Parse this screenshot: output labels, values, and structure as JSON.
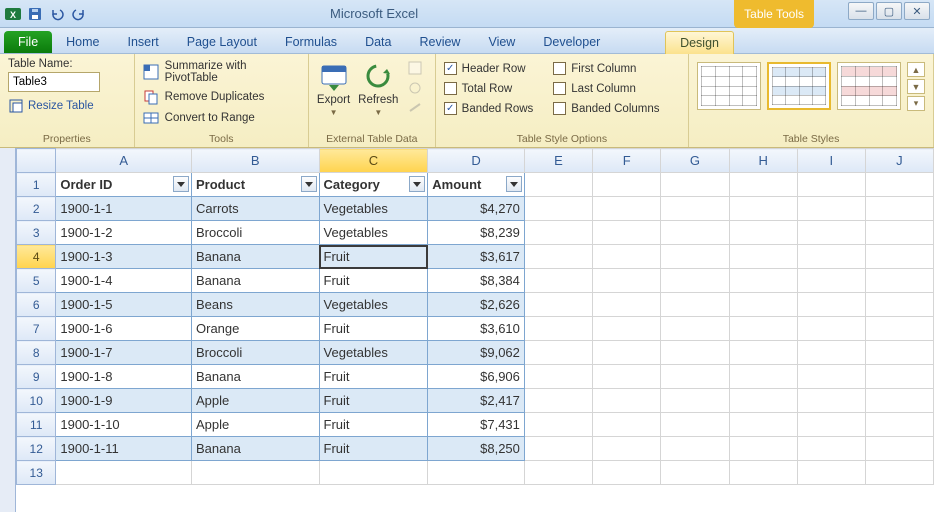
{
  "titlebar": {
    "app_title": "Microsoft Excel",
    "contextual_tab_group": "Table Tools"
  },
  "tabs": {
    "file": "File",
    "list": [
      "Home",
      "Insert",
      "Page Layout",
      "Formulas",
      "Data",
      "Review",
      "View",
      "Developer"
    ],
    "context": "Design"
  },
  "ribbon": {
    "properties": {
      "label": "Properties",
      "table_name_label": "Table Name:",
      "table_name_value": "Table3",
      "resize_label": "Resize Table"
    },
    "tools": {
      "label": "Tools",
      "items": [
        "Summarize with PivotTable",
        "Remove Duplicates",
        "Convert to Range"
      ]
    },
    "external": {
      "label": "External Table Data",
      "export": "Export",
      "refresh": "Refresh"
    },
    "style_options": {
      "label": "Table Style Options",
      "left": [
        "Header Row",
        "Total Row",
        "Banded Rows"
      ],
      "left_checked": [
        true,
        false,
        true
      ],
      "right": [
        "First Column",
        "Last Column",
        "Banded Columns"
      ],
      "right_checked": [
        false,
        false,
        false
      ]
    },
    "styles": {
      "label": "Table Styles"
    }
  },
  "sheet": {
    "columns": [
      "A",
      "B",
      "C",
      "D",
      "E",
      "F",
      "G",
      "H",
      "I",
      "J"
    ],
    "active_col": "C",
    "active_row": 4,
    "headers": [
      "Order ID",
      "Product",
      "Category",
      "Amount"
    ],
    "rows": [
      {
        "r": 2,
        "id": "1900-1-1",
        "product": "Carrots",
        "category": "Vegetables",
        "amount": "$4,270"
      },
      {
        "r": 3,
        "id": "1900-1-2",
        "product": "Broccoli",
        "category": "Vegetables",
        "amount": "$8,239"
      },
      {
        "r": 4,
        "id": "1900-1-3",
        "product": "Banana",
        "category": "Fruit",
        "amount": "$3,617"
      },
      {
        "r": 5,
        "id": "1900-1-4",
        "product": "Banana",
        "category": "Fruit",
        "amount": "$8,384"
      },
      {
        "r": 6,
        "id": "1900-1-5",
        "product": "Beans",
        "category": "Vegetables",
        "amount": "$2,626"
      },
      {
        "r": 7,
        "id": "1900-1-6",
        "product": "Orange",
        "category": "Fruit",
        "amount": "$3,610"
      },
      {
        "r": 8,
        "id": "1900-1-7",
        "product": "Broccoli",
        "category": "Vegetables",
        "amount": "$9,062"
      },
      {
        "r": 9,
        "id": "1900-1-8",
        "product": "Banana",
        "category": "Fruit",
        "amount": "$6,906"
      },
      {
        "r": 10,
        "id": "1900-1-9",
        "product": "Apple",
        "category": "Fruit",
        "amount": "$2,417"
      },
      {
        "r": 11,
        "id": "1900-1-10",
        "product": "Apple",
        "category": "Fruit",
        "amount": "$7,431"
      },
      {
        "r": 12,
        "id": "1900-1-11",
        "product": "Banana",
        "category": "Fruit",
        "amount": "$8,250"
      }
    ],
    "trailing_blank_row": 13
  }
}
